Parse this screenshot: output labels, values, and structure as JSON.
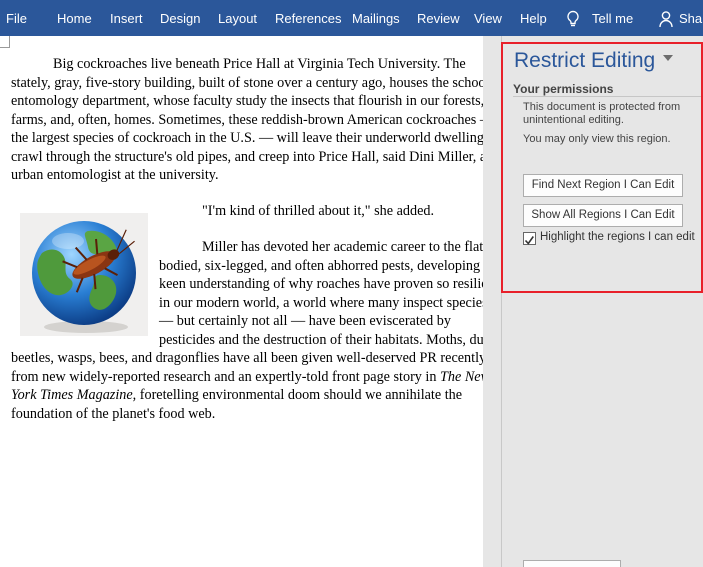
{
  "ribbon": {
    "tabs": [
      "File",
      "Home",
      "Insert",
      "Design",
      "Layout",
      "References",
      "Mailings",
      "Review",
      "View",
      "Help"
    ],
    "tell_me": "Tell me",
    "share": "Share"
  },
  "document": {
    "paragraph1": [
      "Big cockroaches live beneath Price Hall at Virginia Tech University. The",
      "stately, gray, five-story building, built of stone over a century ago, houses the school's",
      "entomology department, whose faculty study the insects that flourish in our forests,",
      "farms, and, often, homes. Sometimes, these reddish-brown American cockroaches —",
      "the largest species of cockroach in the U.S. — will leave their underworld dwellings and",
      "crawl through the structure's old pipes, and creep into Price Hall, said Dini Miller, an",
      "urban entomologist at the university."
    ],
    "paragraph2": "\"I'm kind of thrilled about it,\" she added.",
    "paragraph3_wrapped": [
      "Miller has devoted her academic career to the flat-",
      "bodied, six-legged, and often abhorred pests, developing a",
      "keen understanding of why roaches have proven so resilient",
      "in our modern world, a world where many inspect species",
      "— but certainly not all — have been eviscerated by",
      "pesticides and the destruction of their habitats. Moths, dung"
    ],
    "paragraph3_full": [
      "beetles, wasps, bees, and dragonflies have all been given well-deserved PR recently",
      "from new widely-reported research and an expertly-told front page story in ",
      "foretelling environmental doom should we annihilate the",
      "foundation of the planet's food web."
    ],
    "italic_source_part1": "The New",
    "italic_source_part2": "York Times Magazine,",
    "image_alt": "Cockroach on a globe"
  },
  "pane": {
    "title": "Restrict Editing",
    "section": "Your permissions",
    "info_lines": [
      "This document is protected from",
      "unintentional editing."
    ],
    "view_only": "You may only view this region.",
    "find_next_button": "Find Next Region I Can Edit",
    "show_all_button": "Show All Regions I Can Edit",
    "highlight_checkbox": "Highlight the regions I can edit",
    "highlight_checked": true
  },
  "colors": {
    "ribbon": "#2b579a",
    "pane_title": "#2b579a",
    "highlight_border": "#e8202a"
  }
}
